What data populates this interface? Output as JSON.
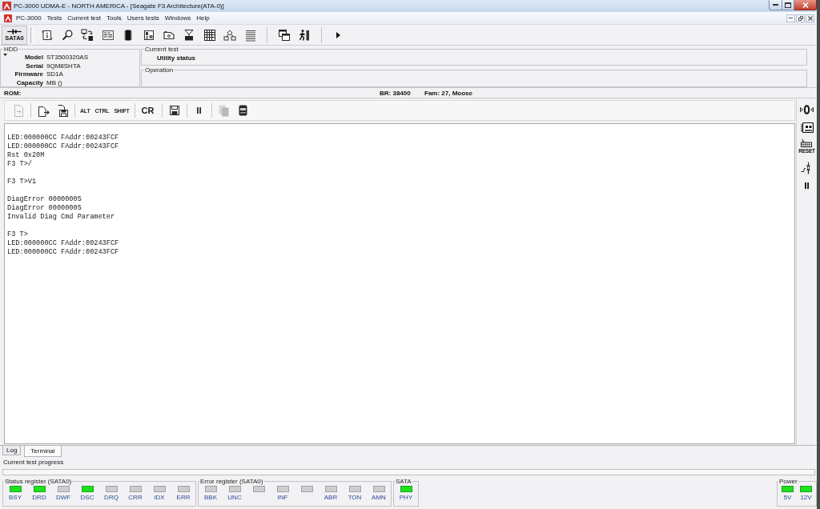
{
  "window": {
    "title": "PC-3000 UDMA-E - NORTH AMERICA - [Seagate F3 Architecture(ATA-0)]"
  },
  "menu": [
    "PC-3000",
    "Tests",
    "Current test",
    "Tools",
    "Users tests",
    "Windows",
    "Help"
  ],
  "toolbar": {
    "port": "SATA0"
  },
  "hdd": {
    "title": "HDD",
    "fields": [
      {
        "label": "Model",
        "value": "ST3500320AS"
      },
      {
        "label": "Serial",
        "value": "9QM8SHTA"
      },
      {
        "label": "Firmware",
        "value": "SD1A"
      },
      {
        "label": "Capacity",
        "value": "MB ()"
      }
    ]
  },
  "current_test": {
    "title": "Current test",
    "status": "Utility status"
  },
  "operation": {
    "title": "Operation"
  },
  "rom_bar": {
    "rom": "ROM:",
    "baud": "BR: 38400",
    "family": "Fam: 27, Moose"
  },
  "terminal_toolbar": {
    "groups": [
      [
        {
          "kind": "export",
          "disabled": true
        }
      ],
      [
        {
          "kind": "open",
          "disabled": false
        },
        {
          "kind": "save_image",
          "disabled": false
        }
      ],
      [
        {
          "kind": "key",
          "label": "ALT",
          "disabled": false
        },
        {
          "kind": "key",
          "label": "CTRL",
          "disabled": false
        },
        {
          "kind": "key",
          "label": "SHIFT",
          "disabled": false
        }
      ],
      [
        {
          "kind": "cr",
          "label": "CR",
          "disabled": false
        }
      ],
      [
        {
          "kind": "save",
          "disabled": false
        }
      ],
      [
        {
          "kind": "pause",
          "disabled": false
        }
      ],
      [
        {
          "kind": "copy",
          "disabled": true
        },
        {
          "kind": "drive",
          "disabled": false
        }
      ]
    ]
  },
  "terminal": {
    "blocks": [
      [
        "LED:000000CC FAddr:00243FCF",
        "LED:000000CC FAddr:00243FCF",
        "Rst 0x20M",
        "F3 T>/"
      ],
      [
        "F3 T>V1"
      ],
      [
        "DiagError 00000005",
        "DiagError 00000005",
        "Invalid Diag Cmd Parameter"
      ],
      [
        "F3 T>",
        "LED:000000CC FAddr:00243FCF",
        "LED:000000CC FAddr:00243FCF"
      ]
    ]
  },
  "side_tools": {
    "reset": "RESET"
  },
  "tabs": [
    {
      "label": "Log",
      "selected": false
    },
    {
      "label": "Terminal",
      "selected": true
    }
  ],
  "progress": {
    "label": "Current test progress",
    "level": 0
  },
  "registers": [
    {
      "title": "Status register (SATA0)",
      "leds": [
        {
          "label": "BSY",
          "on": true
        },
        {
          "label": "DRD",
          "on": true
        },
        {
          "label": "DWF",
          "on": false
        },
        {
          "label": "DSC",
          "on": true
        },
        {
          "label": "DRQ",
          "on": false
        },
        {
          "label": "CRR",
          "on": false
        },
        {
          "label": "IDX",
          "on": false
        },
        {
          "label": "ERR",
          "on": false
        }
      ]
    },
    {
      "title": "Error register (SATA0)",
      "leds": [
        {
          "label": "BBK",
          "on": false
        },
        {
          "label": "UNC",
          "on": false
        },
        {
          "on": false
        },
        {
          "label": "INF",
          "on": false
        },
        {
          "on": false
        },
        {
          "label": "ABR",
          "on": false
        },
        {
          "label": "TON",
          "on": false
        },
        {
          "label": "AMN",
          "on": false
        }
      ]
    },
    {
      "title": "SATA",
      "leds": [
        {
          "label": "PHY",
          "on": true
        }
      ]
    },
    {
      "title": "Power",
      "leds": [
        {
          "label": "5V",
          "on": true
        },
        {
          "label": "12V",
          "on": true
        }
      ]
    }
  ]
}
